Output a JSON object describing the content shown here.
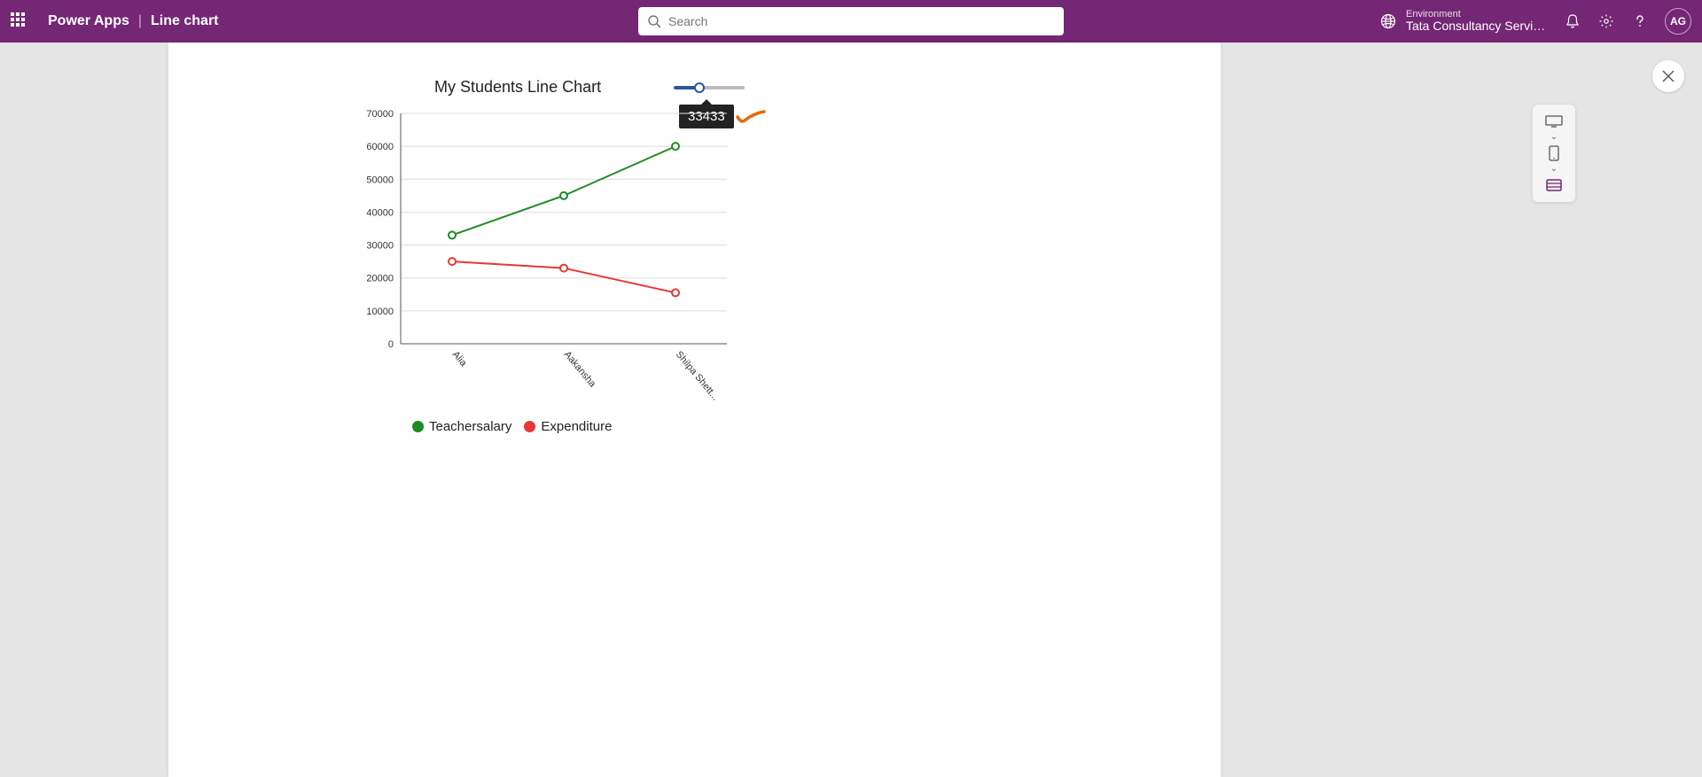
{
  "header": {
    "app_name": "Power Apps",
    "page_name": "Line chart",
    "search_placeholder": "Search",
    "environment_label": "Environment",
    "environment_value": "Tata Consultancy Servic...",
    "avatar_initials": "AG"
  },
  "slider": {
    "tooltip_value": "33433"
  },
  "chart_data": {
    "type": "line",
    "title": "My Students Line Chart",
    "xlabel": "",
    "ylabel": "",
    "ylim": [
      0,
      70000
    ],
    "yticks": [
      0,
      10000,
      20000,
      30000,
      40000,
      50000,
      60000,
      70000
    ],
    "categories": [
      "Alia",
      "Aakansha",
      "Shilpa Shett..."
    ],
    "series": [
      {
        "name": "Teachersalary",
        "color": "#1f8b24",
        "values": [
          33000,
          45000,
          60000
        ]
      },
      {
        "name": "Expenditure",
        "color": "#e53935",
        "values": [
          25000,
          23000,
          15500
        ]
      }
    ]
  }
}
